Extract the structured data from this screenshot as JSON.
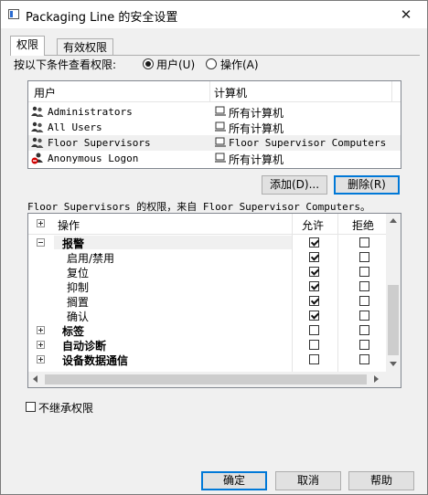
{
  "window": {
    "title": "Packaging Line 的安全设置",
    "close_glyph": "✕"
  },
  "tabs": [
    {
      "label": "权限",
      "active": true
    },
    {
      "label": "有效权限",
      "active": false
    }
  ],
  "view_by": {
    "label": "按以下条件查看权限:",
    "options": [
      {
        "label": "用户(U)",
        "selected": true
      },
      {
        "label": "操作(A)",
        "selected": false
      }
    ]
  },
  "user_list": {
    "columns": [
      "用户",
      "计算机"
    ],
    "rows": [
      {
        "user": "Administrators",
        "computer": "所有计算机",
        "icon": "user-group-icon",
        "selected": false
      },
      {
        "user": "All Users",
        "computer": "所有计算机",
        "icon": "user-group-icon",
        "selected": false
      },
      {
        "user": "Floor Supervisors",
        "computer": "Floor Supervisor Computers",
        "icon": "user-group-icon",
        "selected": true
      },
      {
        "user": "Anonymous Logon",
        "computer": "所有计算机",
        "icon": "anonymous-user-icon",
        "selected": false
      }
    ]
  },
  "buttons": {
    "add": "添加(D)...",
    "remove": "删除(R)",
    "ok": "确定",
    "cancel": "取消",
    "help": "帮助"
  },
  "permission_caption": "Floor Supervisors 的权限，来自 Floor Supervisor Computers。",
  "permissions": {
    "columns": [
      "操作",
      "允许",
      "拒绝"
    ],
    "rows": [
      {
        "label": "报警",
        "level": 0,
        "bold": true,
        "expander": "minus",
        "allow": true,
        "deny": false,
        "highlight": true
      },
      {
        "label": "启用/禁用",
        "level": 1,
        "bold": false,
        "allow": true,
        "deny": false
      },
      {
        "label": "复位",
        "level": 1,
        "bold": false,
        "allow": true,
        "deny": false
      },
      {
        "label": "抑制",
        "level": 1,
        "bold": false,
        "allow": true,
        "deny": false
      },
      {
        "label": "搁置",
        "level": 1,
        "bold": false,
        "allow": true,
        "deny": false
      },
      {
        "label": "确认",
        "level": 1,
        "bold": false,
        "allow": true,
        "deny": false
      },
      {
        "label": "标签",
        "level": 0,
        "bold": true,
        "expander": "plus",
        "allow": false,
        "deny": false
      },
      {
        "label": "自动诊断",
        "level": 0,
        "bold": true,
        "expander": "plus",
        "allow": false,
        "deny": false
      },
      {
        "label": "设备数据通信",
        "level": 0,
        "bold": true,
        "expander": "plus",
        "allow": false,
        "deny": false
      }
    ]
  },
  "inherit_checkbox": {
    "label": "不继承权限",
    "checked": false
  }
}
